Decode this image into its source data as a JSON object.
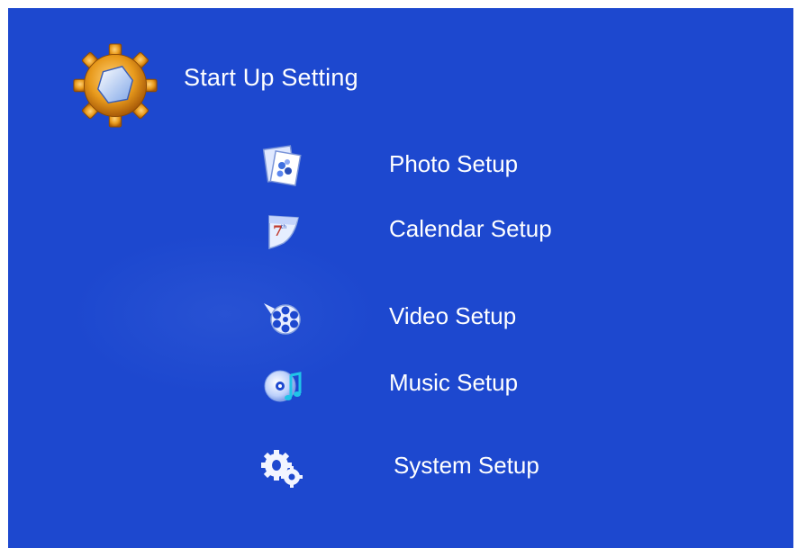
{
  "header": {
    "title": "Start Up Setting",
    "icon": "gear-icon"
  },
  "menu": {
    "items": [
      {
        "label": "Photo Setup",
        "icon": "photo-icon"
      },
      {
        "label": "Calendar Setup",
        "icon": "calendar-icon"
      },
      {
        "label": "Video Setup",
        "icon": "film-reel-icon"
      },
      {
        "label": "Music Setup",
        "icon": "music-disc-icon"
      },
      {
        "label": "System Setup",
        "icon": "system-gears-icon"
      }
    ]
  },
  "colors": {
    "background": "#1d48cf",
    "text": "#ffffff",
    "gear_accent": "#e89a1c"
  }
}
